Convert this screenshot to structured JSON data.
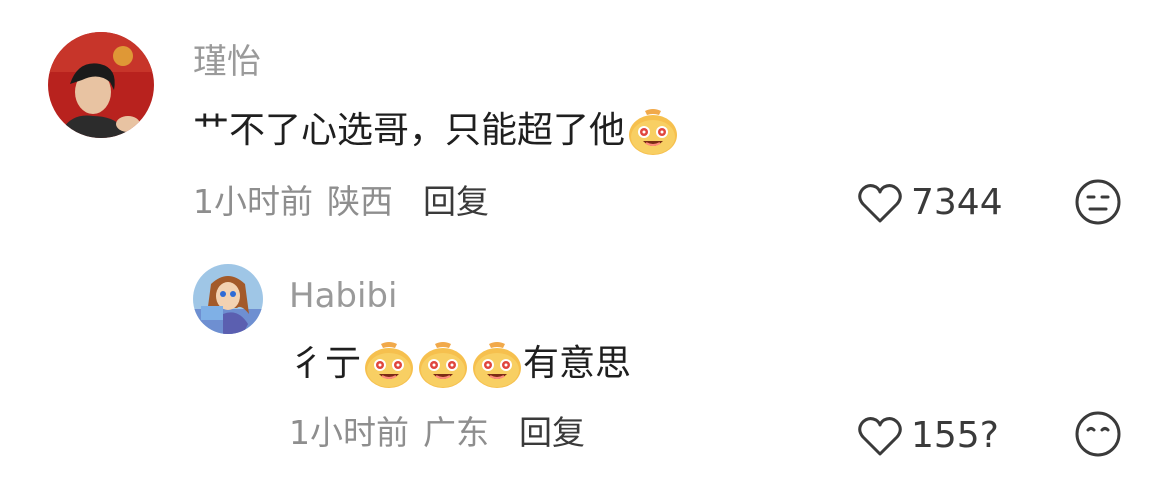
{
  "comments": [
    {
      "username": "瑾怡",
      "content_text": "艹不了心选哥，只能超了他",
      "content_emojis": [
        "grinning-emoji"
      ],
      "time": "1小时前",
      "location": "陕西",
      "reply_label": "回复",
      "like_count": "7344",
      "avatar_icon": "user-avatar"
    },
    {
      "username": "Habibi",
      "content_prefix": "彳亍",
      "content_emojis": [
        "grinning-emoji",
        "grinning-emoji",
        "grinning-emoji"
      ],
      "content_suffix": "有意思",
      "time": "1小时前",
      "location": "广东",
      "reply_label": "回复",
      "like_count": "155?",
      "avatar_icon": "user-avatar"
    }
  ],
  "colors": {
    "username": "#9a9a9a",
    "content": "#1f1f1f",
    "meta": "#8e8e8e",
    "reply": "#3a3a3a"
  }
}
